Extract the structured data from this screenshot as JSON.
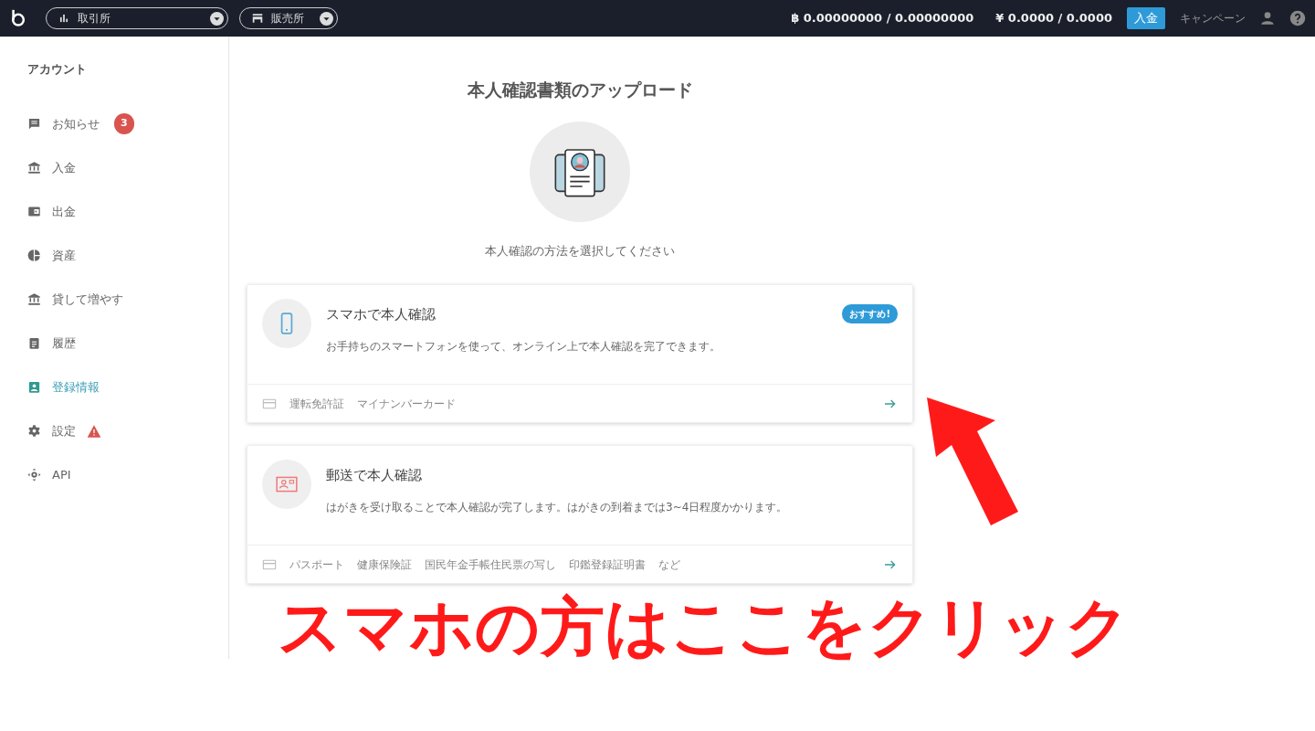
{
  "topbar": {
    "market_selects": [
      {
        "label": "取引所"
      },
      {
        "label": "販売所"
      }
    ],
    "btc_balance": "0.00000000 / 0.00000000",
    "jpy_balance": "0.0000 / 0.0000",
    "btc_symbol": "฿",
    "jpy_symbol": "¥",
    "deposit_button": "入金",
    "campaign_link": "キャンペーン"
  },
  "sidebar": {
    "heading": "アカウント",
    "items": [
      {
        "label": "お知らせ",
        "selected": false,
        "badge": "3"
      },
      {
        "label": "入金",
        "selected": false
      },
      {
        "label": "出金",
        "selected": false
      },
      {
        "label": "資産",
        "selected": false
      },
      {
        "label": "貸して増やす",
        "selected": false
      },
      {
        "label": "履歴",
        "selected": false
      },
      {
        "label": "登録情報",
        "selected": true
      },
      {
        "label": "設定",
        "selected": false,
        "warning": true
      },
      {
        "label": "API",
        "selected": false
      }
    ]
  },
  "main": {
    "title": "本人確認書類のアップロード",
    "subtitle": "本人確認の方法を選択してください",
    "methods": [
      {
        "title": "スマホで本人確認",
        "tag": "おすすめ!",
        "description": "お手持ちのスマートフォンを使って、オンライン上で本人確認を完了できます。",
        "documents": [
          "運転免許証",
          "マイナンバーカード"
        ]
      },
      {
        "title": "郵送で本人確認",
        "description": "はがきを受け取ることで本人確認が完了します。はがきの到着までは3~4日程度かかります。",
        "documents": [
          "パスポート",
          "健康保険証",
          "国民年金手帳住民票の写し",
          "印鑑登録証明書",
          "など"
        ]
      }
    ]
  },
  "annotation": {
    "text": "スマホの方はここをクリック"
  }
}
